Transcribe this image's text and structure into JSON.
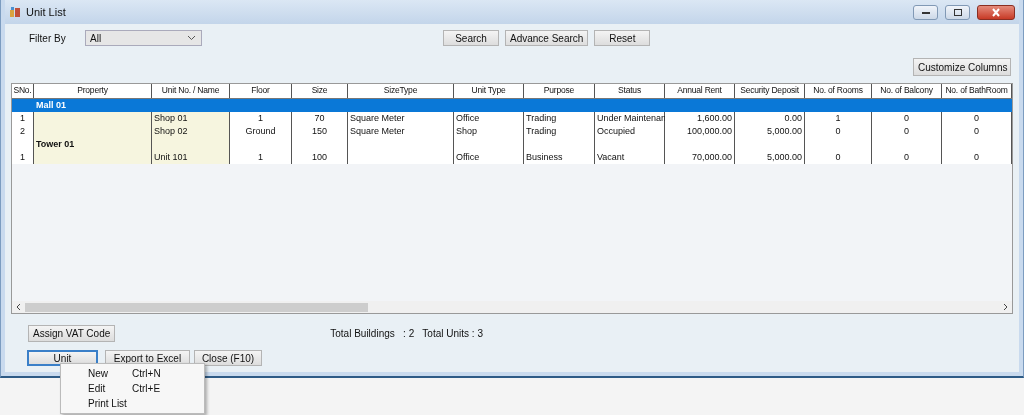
{
  "window": {
    "title": "Unit List"
  },
  "filter": {
    "label": "Filter By",
    "value": "All"
  },
  "buttons": {
    "search": "Search",
    "advance_search": "Advance Search",
    "reset": "Reset",
    "customize": "Customize Columns"
  },
  "table": {
    "columns": [
      "SNo.",
      "Property",
      "Unit No. / Name",
      "Floor",
      "Size",
      "SizeType",
      "Unit Type",
      "Purpose",
      "Status",
      "Annual Rent",
      "Security Deposit",
      "No. of Rooms",
      "No. of Balcony",
      "No. of BathRoom"
    ],
    "rows": [
      {
        "kind": "group",
        "name": "Mall 01",
        "selected": true
      },
      {
        "kind": "unit",
        "selected": false,
        "sno": "1",
        "unit": "Shop 01",
        "floor": "1",
        "size": "70",
        "size_type": "Square Meter",
        "unit_type": "Office",
        "purpose": "Trading",
        "status": "Under Maintenan",
        "annual_rent": "1,600.00",
        "security_deposit": "0.00",
        "rooms": "1",
        "balcony": "0",
        "bathrooms": "0"
      },
      {
        "kind": "unit",
        "selected": false,
        "sno": "2",
        "unit": "Shop 02",
        "floor": "Ground",
        "size": "150",
        "size_type": "Square Meter",
        "unit_type": "Shop",
        "purpose": "Trading",
        "status": "Occupied",
        "annual_rent": "100,000.00",
        "security_deposit": "5,000.00",
        "rooms": "0",
        "balcony": "0",
        "bathrooms": "0"
      },
      {
        "kind": "group",
        "name": "Tower 01",
        "selected": false
      },
      {
        "kind": "unit",
        "selected": false,
        "sno": "1",
        "unit": "Unit 101",
        "floor": "1",
        "size": "100",
        "unit_type": "Office",
        "purpose": "Business",
        "status": "Vacant",
        "annual_rent": "70,000.00",
        "security_deposit": "5,000.00",
        "rooms": "0",
        "balcony": "0",
        "bathrooms": "0"
      }
    ]
  },
  "footer": {
    "assign_vat": "Assign VAT Code",
    "totals": "Total Buildings   : 2   Total Units : 3",
    "unit": "Unit",
    "export": "Export to Excel",
    "close": "Close (F10)"
  },
  "menu": {
    "items": [
      {
        "label": "New",
        "shortcut": "Ctrl+N"
      },
      {
        "label": "Edit",
        "shortcut": "Ctrl+E"
      },
      {
        "label": "Print List"
      }
    ]
  }
}
